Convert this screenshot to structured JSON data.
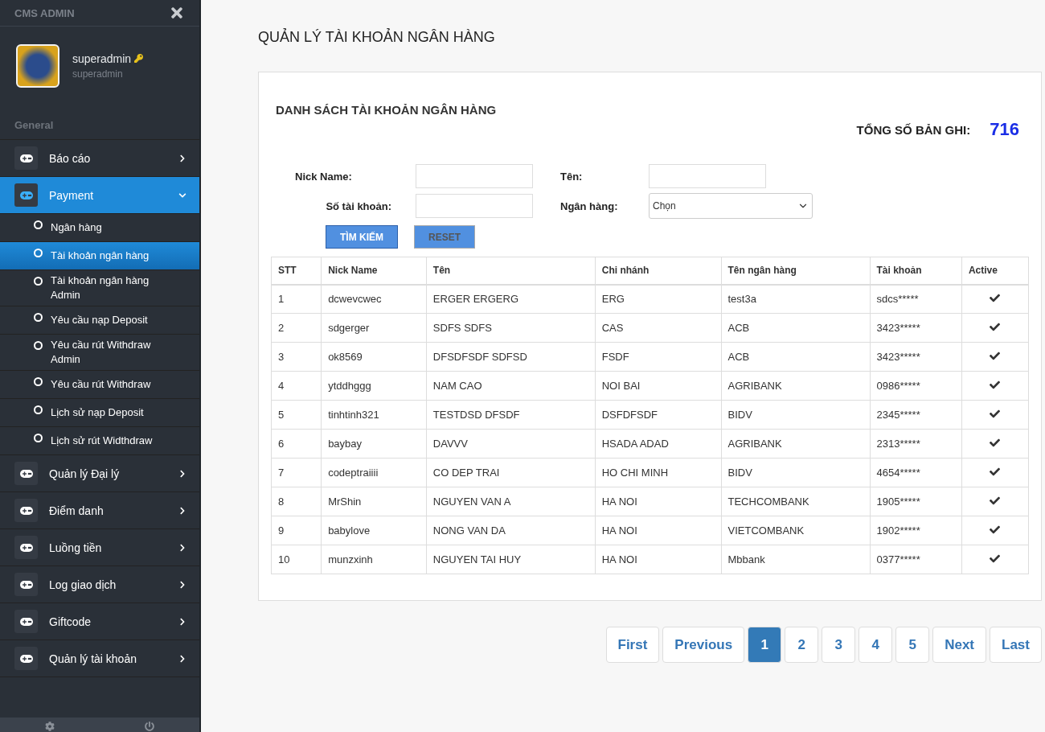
{
  "sidebar": {
    "title": "CMS ADMIN",
    "profile": {
      "name": "superadmin",
      "role": "superadmin"
    },
    "section": "General",
    "items": [
      {
        "label": "Báo cáo",
        "expanded": false,
        "selected": false
      },
      {
        "label": "Payment",
        "expanded": true,
        "selected": true,
        "children": [
          {
            "label": "Ngân hàng",
            "selected": false
          },
          {
            "label": "Tài khoản ngân hàng",
            "selected": true
          },
          {
            "label": "Tài khoản ngân hàng Admin",
            "selected": false
          },
          {
            "label": "Yêu cầu nạp Deposit",
            "selected": false
          },
          {
            "label": "Yêu cầu rút Withdraw Admin",
            "selected": false
          },
          {
            "label": "Yêu cầu rút Withdraw",
            "selected": false
          },
          {
            "label": "Lịch sử nạp Deposit",
            "selected": false
          },
          {
            "label": "Lịch sử rút Widthdraw",
            "selected": false
          }
        ]
      },
      {
        "label": "Quản lý Đại lý",
        "expanded": false,
        "selected": false
      },
      {
        "label": "Điểm danh",
        "expanded": false,
        "selected": false
      },
      {
        "label": "Luồng tiền",
        "expanded": false,
        "selected": false
      },
      {
        "label": "Log giao dịch",
        "expanded": false,
        "selected": false
      },
      {
        "label": "Giftcode",
        "expanded": false,
        "selected": false
      },
      {
        "label": "Quản lý tài khoản",
        "expanded": false,
        "selected": false
      }
    ]
  },
  "page_title": "QUẢN LÝ TÀI KHOẢN NGÂN HÀNG",
  "panel": {
    "title": "DANH SÁCH TÀI KHOẢN NGÂN HÀNG",
    "total_label": "TỔNG SỐ BẢN GHI:",
    "total": "716",
    "filters": [
      {
        "label": "Nick Name:",
        "kind": "text"
      },
      {
        "label": "Tên:",
        "kind": "text"
      },
      {
        "label": "Số tài khoản:",
        "kind": "text"
      },
      {
        "label": "Ngân hàng:",
        "kind": "select",
        "value": "Chọn"
      }
    ],
    "buttons": [
      {
        "label": "TÌM KIẾM",
        "kind": "primary"
      },
      {
        "label": "RESET",
        "kind": "secondary"
      }
    ],
    "table": {
      "columns": [
        "STT",
        "Nick Name",
        "Tên",
        "Chi nhánh",
        "Tên ngân hàng",
        "Tài khoản",
        "Active"
      ],
      "rows": [
        {
          "cells": [
            "1",
            "dcwevcwec",
            "ERGER ERGERG",
            "ERG",
            "test3a",
            "sdcs*****"
          ],
          "active": true
        },
        {
          "cells": [
            "2",
            "sdgerger",
            "SDFS SDFS",
            "CAS",
            "ACB",
            "3423*****"
          ],
          "active": true
        },
        {
          "cells": [
            "3",
            "ok8569",
            "DFSDFSDF SDFSD",
            "FSDF",
            "ACB",
            "3423*****"
          ],
          "active": true
        },
        {
          "cells": [
            "4",
            "ytddhggg",
            "NAM CAO",
            "NOI BAI",
            "AGRIBANK",
            "0986*****"
          ],
          "active": true
        },
        {
          "cells": [
            "5",
            "tinhtinh321",
            "TESTDSD DFSDF",
            "DSFDFSDF",
            "BIDV",
            "2345*****"
          ],
          "active": true
        },
        {
          "cells": [
            "6",
            "baybay",
            "DAVVV",
            "HSADA ADAD",
            "AGRIBANK",
            "2313*****"
          ],
          "active": true
        },
        {
          "cells": [
            "7",
            "codeptraiiii",
            "CO DEP TRAI",
            "HO CHI MINH",
            "BIDV",
            "4654*****"
          ],
          "active": true
        },
        {
          "cells": [
            "8",
            "MrShin",
            "NGUYEN VAN A",
            "HA NOI",
            "TECHCOMBANK",
            "1905*****"
          ],
          "active": true
        },
        {
          "cells": [
            "9",
            "babylove",
            "NONG VAN DA",
            "HA NOI",
            "VIETCOMBANK",
            "1902*****"
          ],
          "active": true
        },
        {
          "cells": [
            "10",
            "munzxinh",
            "NGUYEN TAI HUY",
            "HA NOI",
            "Mbbank",
            "0377*****"
          ],
          "active": true
        }
      ]
    }
  },
  "pagination": [
    {
      "label": "First",
      "selected": false
    },
    {
      "label": "Previous",
      "selected": false
    },
    {
      "label": "1",
      "selected": true
    },
    {
      "label": "2",
      "selected": false
    },
    {
      "label": "3",
      "selected": false
    },
    {
      "label": "4",
      "selected": false
    },
    {
      "label": "5",
      "selected": false
    },
    {
      "label": "Next",
      "selected": false
    },
    {
      "label": "Last",
      "selected": false
    }
  ]
}
